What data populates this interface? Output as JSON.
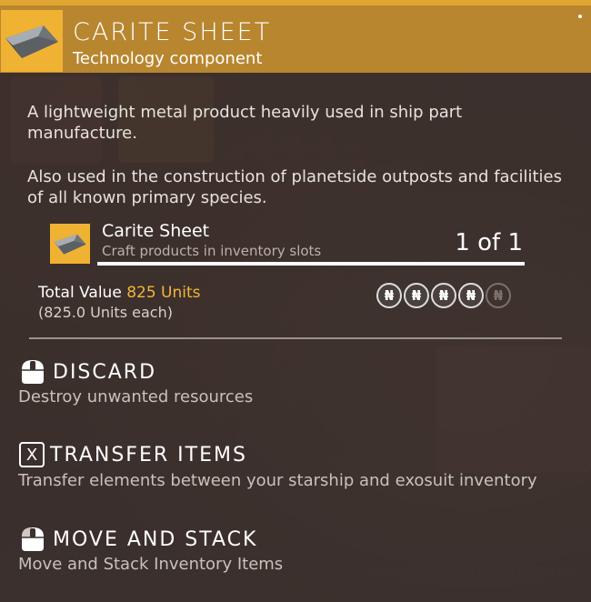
{
  "header": {
    "title": "CARITE SHEET",
    "subtitle": "Technology component",
    "icon": "carite-sheet-icon"
  },
  "description": {
    "line1": "A lightweight metal product heavily used in ship part manufacture.",
    "line2": "Also used in the construction of planetside outposts and facilities of all known primary species."
  },
  "craft": {
    "name": "Carite Sheet",
    "subtitle": "Craft products in inventory slots",
    "count": "1 of 1",
    "progress_fraction": 1.0
  },
  "value": {
    "label": "Total Value",
    "amount": "825 Units",
    "each": "(825.0 Units each)",
    "rating_filled": 4,
    "rating_total": 5
  },
  "actions": [
    {
      "title": "DISCARD",
      "description": "Destroy unwanted resources",
      "icon": "mouse-hold-icon"
    },
    {
      "title": "TRANSFER ITEMS",
      "description": "Transfer elements between your starship and exosuit inventory",
      "icon": "x-key-icon",
      "key": "X"
    },
    {
      "title": "MOVE AND STACK",
      "description": "Move and Stack Inventory Items",
      "icon": "mouse-left-icon"
    }
  ],
  "colors": {
    "header_bg": "#b8862f",
    "accent": "#f0b232",
    "units_text": "#f2b53a"
  }
}
